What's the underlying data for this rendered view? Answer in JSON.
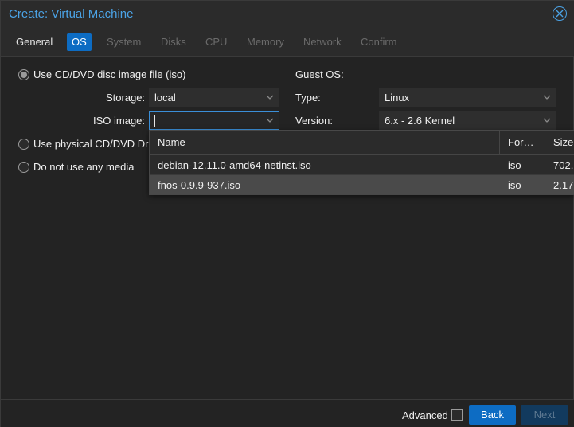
{
  "window": {
    "title": "Create: Virtual Machine"
  },
  "tabs": [
    {
      "label": "General",
      "state": "enabled"
    },
    {
      "label": "OS",
      "state": "active"
    },
    {
      "label": "System",
      "state": "disabled"
    },
    {
      "label": "Disks",
      "state": "disabled"
    },
    {
      "label": "CPU",
      "state": "disabled"
    },
    {
      "label": "Memory",
      "state": "disabled"
    },
    {
      "label": "Network",
      "state": "disabled"
    },
    {
      "label": "Confirm",
      "state": "disabled"
    }
  ],
  "media": {
    "option_iso": "Use CD/DVD disc image file (iso)",
    "storage_label": "Storage:",
    "storage_value": "local",
    "iso_label": "ISO image:",
    "iso_value": "",
    "option_physical": "Use physical CD/DVD Dr",
    "option_none": "Do not use any media"
  },
  "guest_os": {
    "heading": "Guest OS:",
    "type_label": "Type:",
    "type_value": "Linux",
    "version_label": "Version:",
    "version_value": "6.x - 2.6 Kernel"
  },
  "iso_dropdown": {
    "columns": [
      "Name",
      "For…",
      "Size"
    ],
    "rows": [
      {
        "name": "debian-12.11.0-amd64-netinst.iso",
        "format": "iso",
        "size": "702.",
        "selected": false
      },
      {
        "name": "fnos-0.9.9-937.iso",
        "format": "iso",
        "size": "2.17",
        "selected": true
      }
    ]
  },
  "footer": {
    "advanced_label": "Advanced",
    "advanced_checked": false,
    "back_label": "Back",
    "next_label": "Next"
  },
  "colors": {
    "accent": "#0d6cc3",
    "title": "#4ba3e6",
    "background": "#232323"
  }
}
